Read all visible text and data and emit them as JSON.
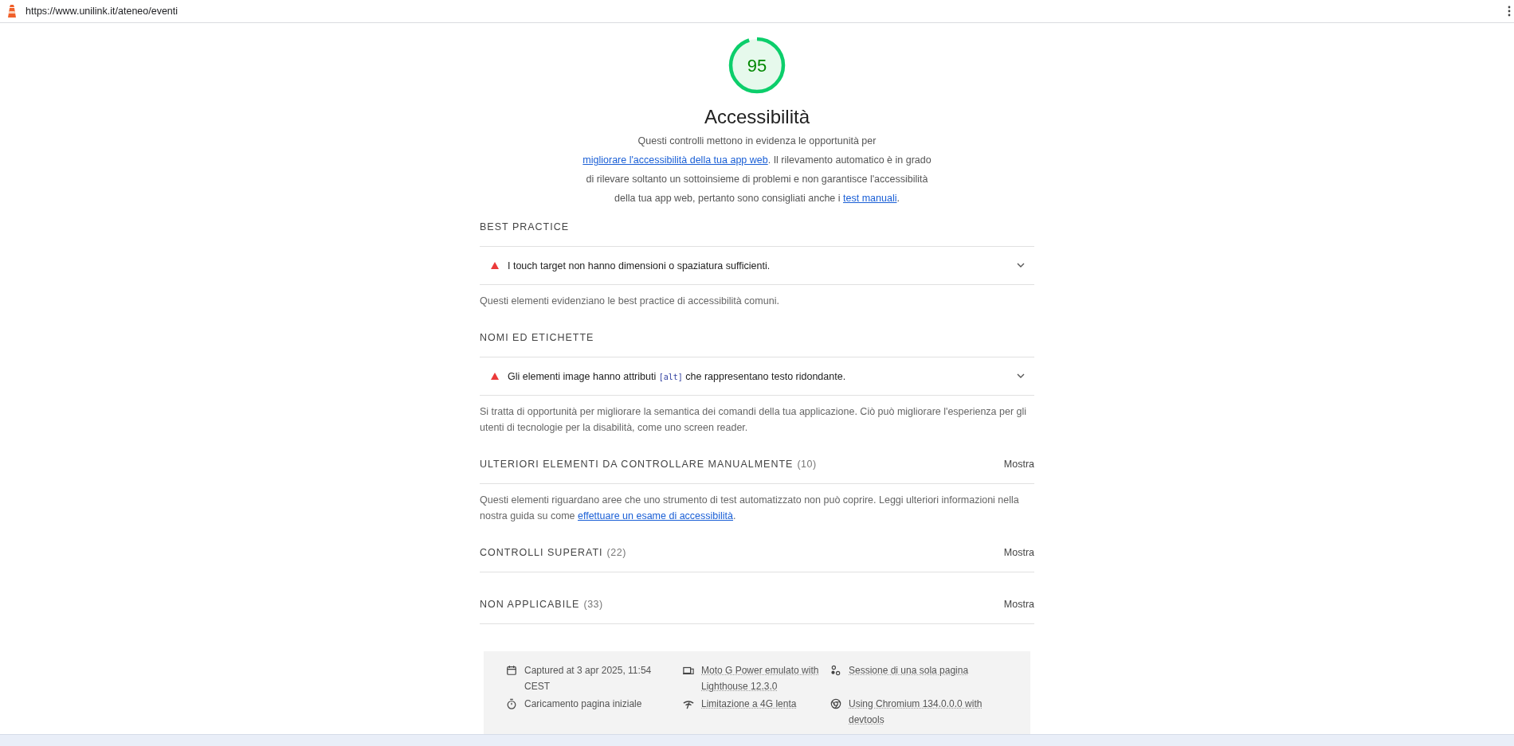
{
  "address_bar": {
    "url": "https://www.unilink.it/ateneo/eventi"
  },
  "gauge": {
    "score": "95",
    "level": 0.95
  },
  "title": "Accessibilità",
  "description": [
    {
      "kind": "text",
      "text": "Questi controlli mettono in evidenza le opportunità per "
    },
    {
      "kind": "link",
      "text": "migliorare l'accessibilità della tua app web"
    },
    {
      "kind": "text",
      "text": ". Il rilevamento automatico è in grado di rilevare soltanto un sottoinsieme di problemi e non garantisce l'accessibilità della tua app web, pertanto sono consigliati anche i "
    },
    {
      "kind": "link",
      "text": "test manuali"
    },
    {
      "kind": "text",
      "text": "."
    }
  ],
  "groups": [
    {
      "heading": "BEST PRACTICE",
      "audits": [
        {
          "parts": [
            {
              "kind": "text",
              "text": "I touch target non hanno dimensioni o spaziatura sufficienti."
            }
          ],
          "expanded": false
        }
      ],
      "description": [
        {
          "kind": "text",
          "text": "Questi elementi evidenziano le best practice di accessibilità comuni."
        }
      ]
    },
    {
      "heading": "NOMI ED ETICHETTE",
      "audits": [
        {
          "parts": [
            {
              "kind": "text",
              "text": "Gli elementi image hanno attributi "
            },
            {
              "kind": "code",
              "text": "[alt]"
            },
            {
              "kind": "text",
              "text": " che rappresentano testo ridondante."
            }
          ],
          "expanded": false
        }
      ],
      "description": [
        {
          "kind": "text",
          "text": "Si tratta di opportunità per migliorare la semantica dei comandi della tua applicazione. Ciò può migliorare l'esperienza per gli utenti di tecnologie per la disabilità, come uno screen reader."
        }
      ]
    },
    {
      "heading": "ULTERIORI ELEMENTI DA CONTROLLARE MANUALMENTE",
      "count": "(10)",
      "toggle": "Mostra",
      "description": [
        {
          "kind": "text",
          "text": "Questi elementi riguardano aree che uno strumento di test automatizzato non può coprire. Leggi ulteriori informazioni nella nostra guida su come "
        },
        {
          "kind": "link",
          "text": "effettuare un esame di accessibilità"
        },
        {
          "kind": "text",
          "text": "."
        }
      ]
    },
    {
      "heading": "CONTROLLI SUPERATI",
      "count": "(22)",
      "toggle": "Mostra"
    },
    {
      "heading": "NON APPLICABILE",
      "count": "(33)",
      "toggle": "Mostra"
    }
  ],
  "footer": {
    "items": [
      {
        "text": "Captured at 3 apr 2025, 11:54 CEST",
        "dotted": false
      },
      {
        "text": "Moto G Power emulato with Lighthouse 12.3.0",
        "dotted": true
      },
      {
        "text": "Sessione di una sola pagina",
        "dotted": true
      },
      {
        "text": "Caricamento pagina iniziale",
        "dotted": false
      },
      {
        "text": "Limitazione a 4G lenta",
        "dotted": true
      },
      {
        "text": "Using Chromium 134.0.0.0 with devtools",
        "dotted": true
      }
    ]
  }
}
